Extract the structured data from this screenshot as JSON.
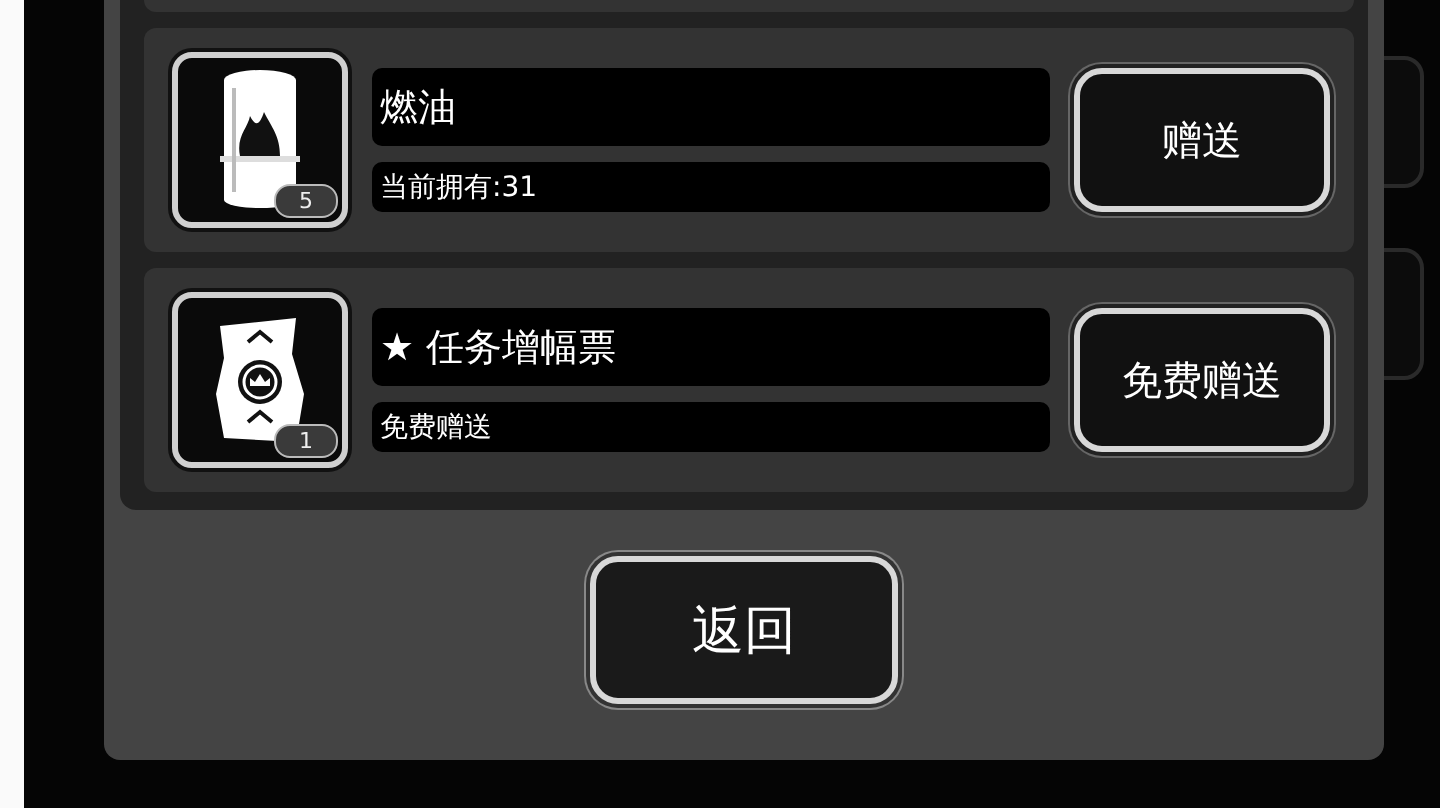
{
  "items": [
    {
      "kind": "barrel",
      "name": "燃油",
      "detail": "当前拥有:31",
      "count": "5",
      "action": "赠送"
    },
    {
      "kind": "ticket",
      "name": "★ 任务增幅票",
      "detail": "免费赠送",
      "count": "1",
      "action": "免费赠送"
    }
  ],
  "return_button": "返回"
}
